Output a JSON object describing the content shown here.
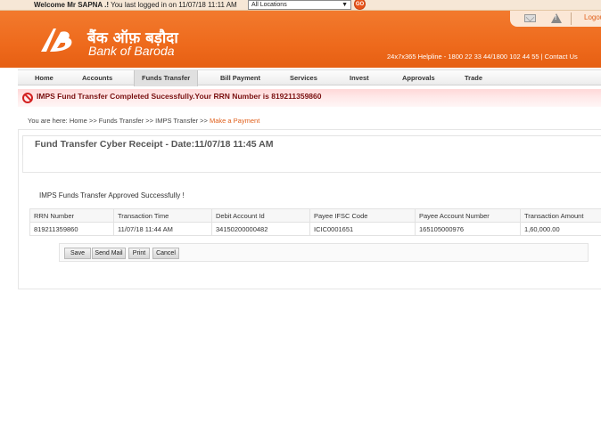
{
  "topbar": {
    "welcome_bold": "Welcome Mr SAPNA .!",
    "welcome_rest": " You last logged in on 11/07/18 11:11 AM",
    "location_value": "All Locations",
    "go_label": "GO"
  },
  "header": {
    "brand_hindi": "बैंक ऑफ़ बड़ौदा",
    "brand_english": "Bank of Baroda",
    "helpline": "24x7x365 Helpline - 1800 22 33 44/1800 102 44 55  |  Contact Us",
    "logout_label": "Logout",
    "icons": {
      "mail": "mail-icon",
      "alert": "warning-icon",
      "brand": "bob-logo-icon"
    }
  },
  "nav": {
    "items": [
      "Home",
      "Accounts",
      "Funds Transfer",
      "Bill Payment",
      "Services",
      "Invest",
      "Approvals",
      "Trade"
    ],
    "active": "Funds Transfer"
  },
  "status": {
    "icon": "no-entry-icon",
    "message": "IMPS Fund Transfer Completed Sucessfully.Your RRN Number is 819211359860"
  },
  "breadcrumb": {
    "prefix": "You are here: ",
    "trail": "Home >> Funds Transfer >> IMPS Transfer >> ",
    "current": "Make a Payment"
  },
  "receipt": {
    "title": "Fund Transfer Cyber Receipt - Date:11/07/18 11:45 AM",
    "approved_message": "IMPS Funds Transfer Approved Successfully !",
    "columns": [
      "RRN Number",
      "Transaction Time",
      "Debit Account Id",
      "Payee IFSC Code",
      "Payee Account Number",
      "Transaction Amount"
    ],
    "rows": [
      [
        "819211359860",
        "11/07/18 11:44 AM",
        "34150200000482",
        "ICIC0001651",
        "165105000976",
        "1,60,000.00"
      ]
    ]
  },
  "actions": {
    "save": "Save",
    "send_mail": "Send Mail",
    "print": "Print",
    "cancel": "Cancel"
  },
  "colors": {
    "brand_orange": "#ee6a1c",
    "error_red": "#d32020",
    "link_orange": "#e0601c"
  }
}
